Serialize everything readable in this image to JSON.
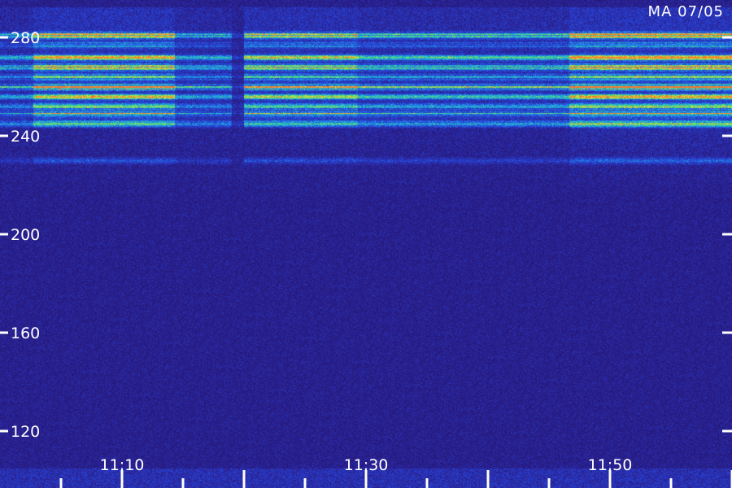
{
  "chart_data": {
    "type": "heatmap",
    "title": "MA 07/05",
    "xlabel": "",
    "ylabel": "",
    "x_ticks": [
      "11:10",
      "11:30",
      "11:50"
    ],
    "y_ticks": [
      "280",
      "240",
      "200",
      "160",
      "120"
    ],
    "x_range_minutes": [
      11.0,
      70.0
    ],
    "y_range": [
      108,
      298
    ],
    "colors": {
      "background": "#1b1060",
      "low": "#2a1e8a",
      "mid": "#1f5ad8",
      "high": "#46e070",
      "peak": "#ffe030",
      "axis": "#ffffff"
    },
    "bands": [
      {
        "y": 281,
        "intensity": 0.85
      },
      {
        "y": 277,
        "intensity": 0.5
      },
      {
        "y": 272,
        "intensity": 0.75
      },
      {
        "y": 268,
        "intensity": 0.8
      },
      {
        "y": 264,
        "intensity": 0.55
      },
      {
        "y": 260,
        "intensity": 0.9
      },
      {
        "y": 256,
        "intensity": 0.7
      },
      {
        "y": 252,
        "intensity": 0.55
      },
      {
        "y": 249,
        "intensity": 0.8
      },
      {
        "y": 245,
        "intensity": 0.6
      },
      {
        "y": 230,
        "intensity": 0.25
      }
    ],
    "grid": false
  }
}
